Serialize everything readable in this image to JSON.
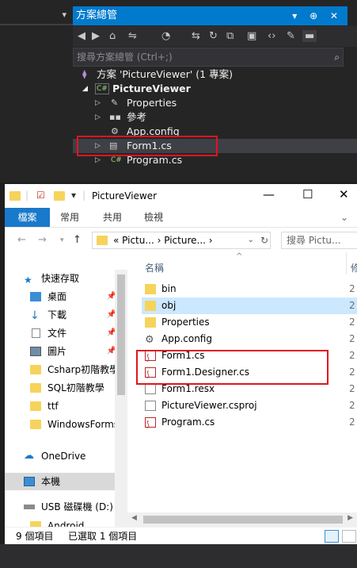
{
  "vs": {
    "panel_title": "方案總管",
    "title_buttons": "▾ ⊕ ✕",
    "toolbar_icons": [
      "back-icon",
      "forward-icon",
      "home-icon",
      "sync-icon",
      "history-icon",
      "switch-icon",
      "refresh-icon",
      "collapse-icon",
      "code-icon",
      "wrench-icon",
      "preview-icon"
    ],
    "search_placeholder": "搜尋方案總管 (Ctrl+;)",
    "tree": [
      {
        "label": "方案 'PictureViewer' (1 專案)"
      },
      {
        "label": "PictureViewer"
      },
      {
        "label": "Properties"
      },
      {
        "label": "參考"
      },
      {
        "label": "App.config"
      },
      {
        "label": "Form1.cs"
      },
      {
        "label": "Program.cs"
      }
    ]
  },
  "explorer": {
    "title": "PictureViewer",
    "ribbon_tabs": [
      "檔案",
      "常用",
      "共用",
      "檢視"
    ],
    "address": "« Pictu... › Picture... ›",
    "search_placeholder": "搜尋 Pictu...",
    "nav_items": [
      {
        "label": "快速存取"
      },
      {
        "label": "桌面"
      },
      {
        "label": "下載"
      },
      {
        "label": "文件"
      },
      {
        "label": "圖片"
      },
      {
        "label": "Csharp初階教學"
      },
      {
        "label": "SQL初階教學"
      },
      {
        "label": "ttf"
      },
      {
        "label": "WindowsForms"
      },
      {
        "label": "OneDrive"
      },
      {
        "label": "本機"
      },
      {
        "label": "USB 磁碟機 (D:)"
      },
      {
        "label": "Android"
      }
    ],
    "column_name": "名稱",
    "column_cut": "修",
    "files": [
      {
        "label": "bin",
        "type": "folder",
        "date_cut": "2"
      },
      {
        "label": "obj",
        "type": "folder",
        "date_cut": "2"
      },
      {
        "label": "Properties",
        "type": "folder",
        "date_cut": "2"
      },
      {
        "label": "App.config",
        "type": "config",
        "date_cut": "2"
      },
      {
        "label": "Form1.cs",
        "type": "cs",
        "date_cut": "2"
      },
      {
        "label": "Form1.Designer.cs",
        "type": "cs",
        "date_cut": "2"
      },
      {
        "label": "Form1.resx",
        "type": "resx",
        "date_cut": "2"
      },
      {
        "label": "PictureViewer.csproj",
        "type": "doc",
        "date_cut": "2"
      },
      {
        "label": "Program.cs",
        "type": "cs",
        "date_cut": "2"
      }
    ],
    "status_count": "9 個項目",
    "status_selected": "已選取 1 個項目"
  },
  "colors": {
    "vs_accent": "#007acc",
    "file_tab": "#1979ca",
    "highlight_red": "#e0151f",
    "selected_row": "#cce8ff"
  }
}
